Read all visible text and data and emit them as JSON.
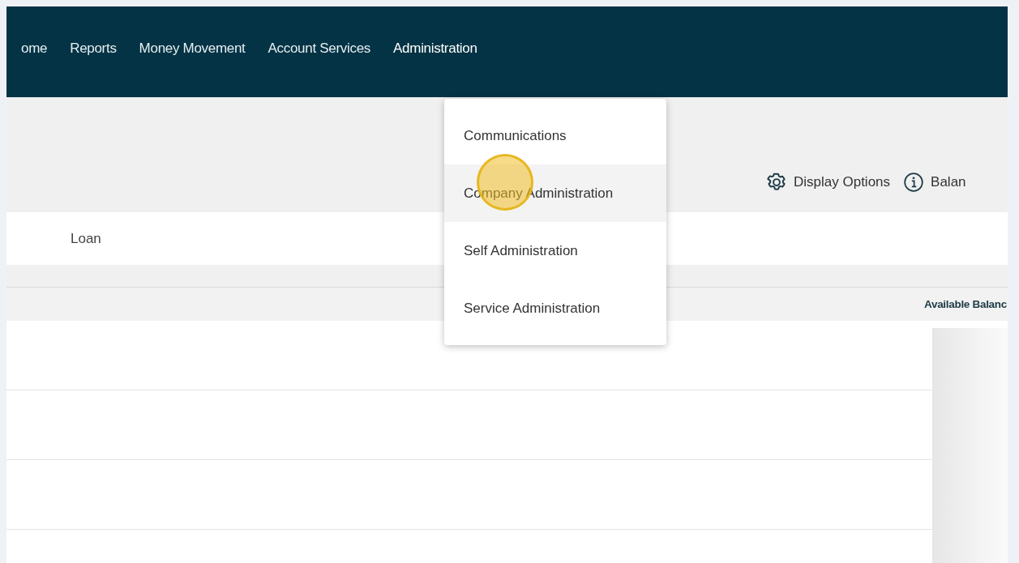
{
  "nav": {
    "items": [
      {
        "label": "ome",
        "selected": false
      },
      {
        "label": "Reports",
        "selected": false
      },
      {
        "label": "Money Movement",
        "selected": false
      },
      {
        "label": "Account Services",
        "selected": false
      },
      {
        "label": "Administration",
        "selected": true
      }
    ]
  },
  "dropdown": {
    "items": [
      {
        "label": "Communications",
        "selected": false
      },
      {
        "label": "Company Administration",
        "selected": true
      },
      {
        "label": "Self Administration",
        "selected": false
      },
      {
        "label": "Service Administration",
        "selected": false
      }
    ]
  },
  "toolbar": {
    "display_options": "Display Options",
    "balance": "Balan"
  },
  "account_type_tab": "Loan",
  "table": {
    "columns": [
      "Available Balanc"
    ]
  }
}
